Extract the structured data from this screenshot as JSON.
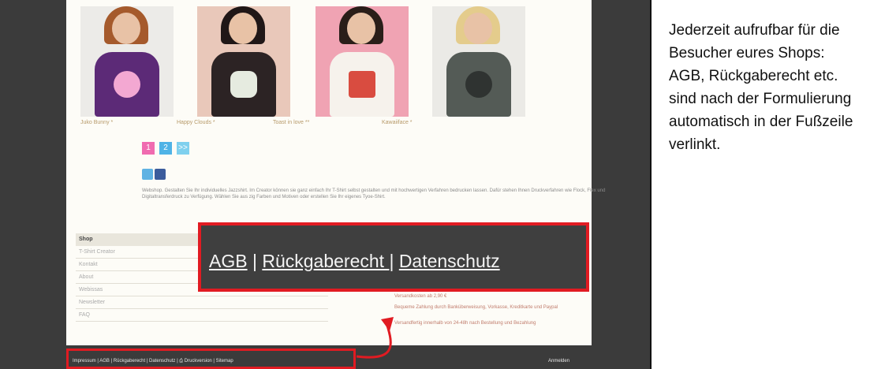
{
  "products": [
    {
      "name": "Juko Bunny *"
    },
    {
      "name": "Happy Clouds *"
    },
    {
      "name": "Toast in love **"
    },
    {
      "name": "Kawaiiface *"
    }
  ],
  "pagination": [
    "1",
    "2",
    ">>"
  ],
  "blurb": "Webshop. Gestalten Sie Ihr individuelles Jazzshirt. Im Creator können sie ganz einfach Ihr T-Shirt selbst gestalten und mit hochwertigen Verfahren bedrucken lassen. Dafür stehen Ihnen Druckverfahren wie Flock, Flex und Digitaltransferdruck zu Verfügung. Wählen Sie aus zig Farben und Motiven oder erstellen Sie Ihr eigenes Tyoe-Shirt.",
  "menu": {
    "header": "Shop",
    "items": [
      "T-Shirt Creator",
      "Kontakt",
      "About",
      "Webissas",
      "Newsletter",
      "FAQ"
    ]
  },
  "info_lines": [
    "Versandkosten ab 2,90 €",
    "Bequeme Zahlung durch Banküberweisung, Vorkasse, Kreditkarte und Paypal",
    "Versandfertig innerhalb von 24-48h nach Bestellung und Bezahlung"
  ],
  "footer": {
    "links": "Impressum | AGB | Rückgaberecht | Datenschutz | ⎙ Druckversion | Sitemap",
    "login": "Anmelden"
  },
  "callout": {
    "agb": "AGB",
    "sep1": " | ",
    "rueckgabe": "Rückgaberecht ",
    "sep2": "| ",
    "datenschutz": "Datenschutz"
  },
  "description": "Jederzeit aufrufbar für die Besucher eures Shops: AGB, Rückgaberecht etc. sind nach der Formulierung automatisch in der Fußzeile verlinkt.",
  "colors": {
    "highlight": "#e11b22",
    "frame": "#3b3b3b"
  }
}
